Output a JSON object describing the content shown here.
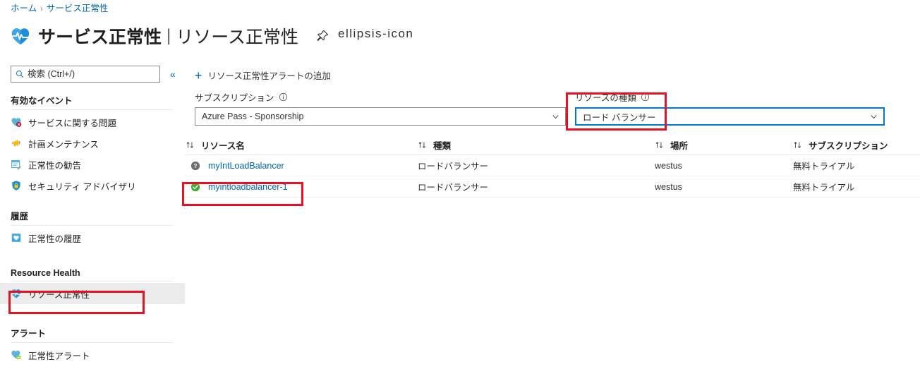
{
  "breadcrumb": {
    "home": "ホーム",
    "separator": "›",
    "current": "サービス正常性"
  },
  "header": {
    "app_icon": "service-health-heart-icon",
    "title": "サービス正常性",
    "pipe": "|",
    "subtitle": "リソース正常性",
    "pin_icon": "pin-icon",
    "more_icon": "ellipsis-icon"
  },
  "sidebar": {
    "search": {
      "placeholder": "検索 (Ctrl+/)",
      "value": "",
      "icon": "search-icon"
    },
    "collapse": "«",
    "groups": [
      {
        "header": "有効なイベント",
        "items": [
          {
            "label": "サービスに関する問題",
            "icon": "service-issue-icon",
            "selected": false
          },
          {
            "label": "計画メンテナンス",
            "icon": "megaphone-icon",
            "selected": false
          },
          {
            "label": "正常性の勧告",
            "icon": "health-advisory-icon",
            "selected": false
          },
          {
            "label": "セキュリティ アドバイザリ",
            "icon": "shield-lock-icon",
            "selected": false
          }
        ]
      },
      {
        "header": "履歴",
        "items": [
          {
            "label": "正常性の履歴",
            "icon": "health-history-icon",
            "selected": false
          }
        ]
      },
      {
        "header": "Resource Health",
        "items": [
          {
            "label": "リソース正常性",
            "icon": "resource-health-icon",
            "selected": true
          }
        ]
      },
      {
        "header": "アラート",
        "items": [
          {
            "label": "正常性アラート",
            "icon": "health-alert-icon",
            "selected": false
          }
        ]
      }
    ]
  },
  "main": {
    "command": {
      "label": "リソース正常性アラートの追加",
      "icon": "plus-icon"
    },
    "filters": {
      "subscription": {
        "label": "サブスクリプション",
        "info_icon": "info-icon",
        "value": "Azure Pass - Sponsorship",
        "chevron": "chevron-down-icon"
      },
      "resource_type": {
        "label": "リソースの種類",
        "info_icon": "info-icon",
        "value": "ロード バランサー",
        "chevron": "chevron-down-icon"
      }
    },
    "table": {
      "columns": [
        "リソース名",
        "種類",
        "場所",
        "サブスクリプション"
      ],
      "sort_icon": "sort-arrows-icon",
      "rows": [
        {
          "status": "unknown",
          "status_icon": "question-circle-icon",
          "name": "myIntLoadBalancer",
          "type": "ロードバランサー",
          "location": "westus",
          "subscription": "無料トライアル"
        },
        {
          "status": "available",
          "status_icon": "check-circle-icon",
          "name": "myintloadbalancer-1",
          "type": "ロードバランサー",
          "location": "westus",
          "subscription": "無料トライアル"
        }
      ]
    }
  },
  "annotations": {
    "color": "#e81123",
    "boxes": [
      {
        "name": "resource-type-filter-highlight"
      },
      {
        "name": "selected-resource-row-highlight"
      },
      {
        "name": "sidebar-resource-health-highlight"
      }
    ]
  }
}
